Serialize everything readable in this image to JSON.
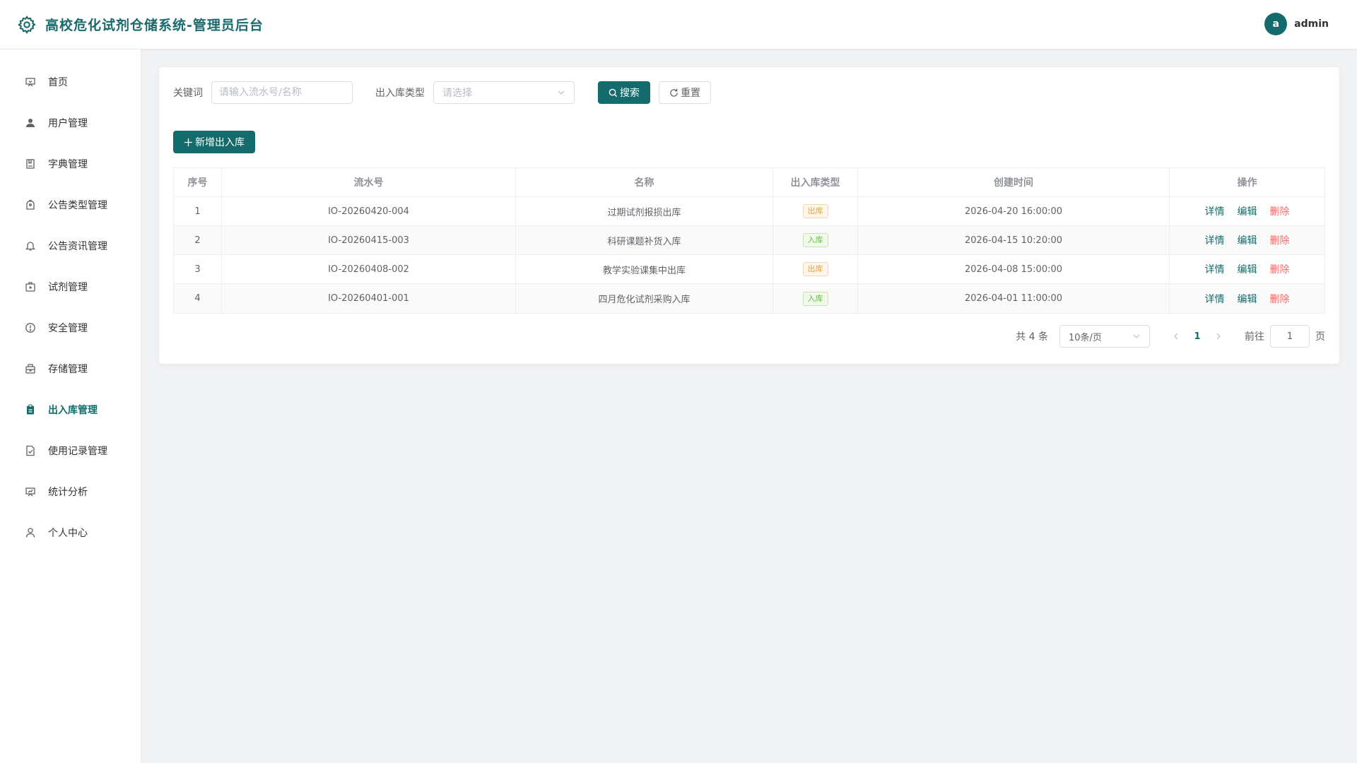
{
  "header": {
    "title": "高校危化试剂仓储系统-管理员后台",
    "avatar_letter": "a",
    "username": "admin",
    "accent_color": "#136b6b"
  },
  "sidebar": {
    "items": [
      {
        "label": "首页",
        "icon": "home-icon",
        "active": false
      },
      {
        "label": "用户管理",
        "icon": "user-icon",
        "active": false
      },
      {
        "label": "字典管理",
        "icon": "book-icon",
        "active": false
      },
      {
        "label": "公告类型管理",
        "icon": "tag-icon",
        "active": false
      },
      {
        "label": "公告资讯管理",
        "icon": "bell-icon",
        "active": false
      },
      {
        "label": "试剂管理",
        "icon": "box-icon",
        "active": false
      },
      {
        "label": "安全管理",
        "icon": "warning-icon",
        "active": false
      },
      {
        "label": "存储管理",
        "icon": "storage-icon",
        "active": false
      },
      {
        "label": "出入库管理",
        "icon": "clipboard-icon",
        "active": true
      },
      {
        "label": "使用记录管理",
        "icon": "record-icon",
        "active": false
      },
      {
        "label": "统计分析",
        "icon": "chart-icon",
        "active": false
      },
      {
        "label": "个人中心",
        "icon": "person-icon",
        "active": false
      }
    ]
  },
  "filters": {
    "keyword_label": "关键词",
    "keyword_placeholder": "请输入流水号/名称",
    "type_label": "出入库类型",
    "type_placeholder": "请选择",
    "search_label": "搜索",
    "reset_label": "重置"
  },
  "actions": {
    "add_label": "新增出入库"
  },
  "table": {
    "columns": [
      "序号",
      "流水号",
      "名称",
      "出入库类型",
      "创建时间",
      "操作"
    ],
    "rows": [
      {
        "no": "1",
        "serial": "IO-20260420-004",
        "name": "过期试剂报损出库",
        "type": "出库",
        "kind": "out",
        "time": "2026-04-20 16:00:00"
      },
      {
        "no": "2",
        "serial": "IO-20260415-003",
        "name": "科研课题补货入库",
        "type": "入库",
        "kind": "in",
        "time": "2026-04-15 10:20:00"
      },
      {
        "no": "3",
        "serial": "IO-20260408-002",
        "name": "教学实验课集中出库",
        "type": "出库",
        "kind": "out",
        "time": "2026-04-08 15:00:00"
      },
      {
        "no": "4",
        "serial": "IO-20260401-001",
        "name": "四月危化试剂采购入库",
        "type": "入库",
        "kind": "in",
        "time": "2026-04-01 11:00:00"
      }
    ],
    "ops": {
      "detail": "详情",
      "edit": "编辑",
      "delete": "删除"
    }
  },
  "pagination": {
    "total_text": "共 4 条",
    "page_size": "10条/页",
    "current_page": "1",
    "goto_label": "前往",
    "goto_value": "1",
    "page_suffix": "页"
  }
}
